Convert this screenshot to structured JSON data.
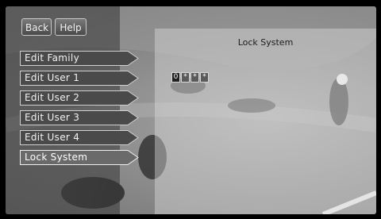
{
  "header": {
    "back_label": "Back",
    "help_label": "Help"
  },
  "menu": {
    "items": [
      {
        "label": "Edit Family"
      },
      {
        "label": "Edit User 1"
      },
      {
        "label": "Edit User 2"
      },
      {
        "label": "Edit User 3"
      },
      {
        "label": "Edit User 4"
      },
      {
        "label": "Lock System",
        "selected": true
      }
    ]
  },
  "dialog": {
    "title": "Lock System",
    "pin": [
      "0",
      "*",
      "*",
      "*"
    ]
  },
  "colors": {
    "menu_fill": "#4a4a4a",
    "menu_selected_fill": "#6a6a6a",
    "menu_border": "#d0d0d0"
  },
  "icons": [
    "arrow-tab-shape"
  ]
}
